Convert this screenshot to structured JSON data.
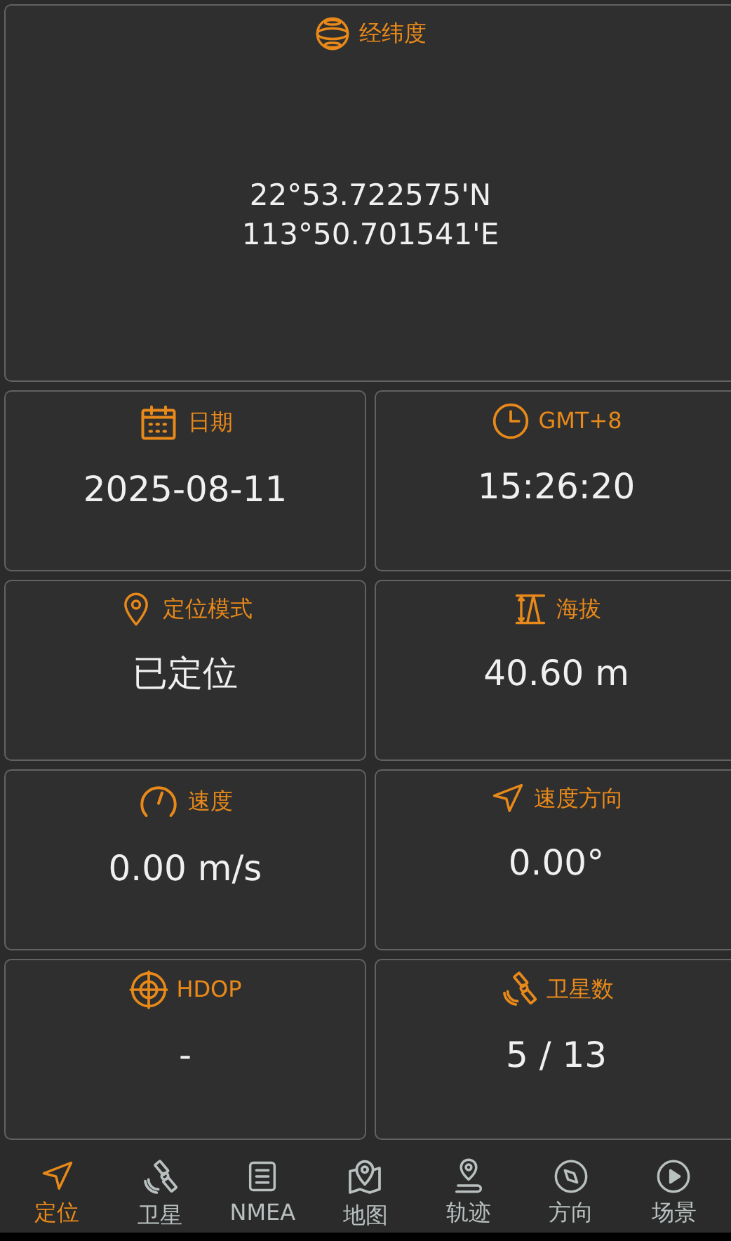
{
  "coordinates": {
    "label": "经纬度",
    "lines": [
      "22°53.722575'N",
      "113°50.701541'E"
    ]
  },
  "cards": [
    {
      "label": "日期",
      "value": "2025-08-11"
    },
    {
      "label": "GMT+8",
      "value": "15:26:20"
    },
    {
      "label": "定位模式",
      "value": "已定位"
    },
    {
      "label": "海拔",
      "value": "40.60 m"
    },
    {
      "label": "速度",
      "value": "0.00 m/s"
    },
    {
      "label": "速度方向",
      "value": "0.00°"
    },
    {
      "label": "HDOP",
      "value": "-"
    },
    {
      "label": "卫星数",
      "value": "5 / 13"
    }
  ],
  "nav": [
    {
      "label": "定位",
      "selected": true
    },
    {
      "label": "卫星",
      "selected": false
    },
    {
      "label": "NMEA",
      "selected": false
    },
    {
      "label": "地图",
      "selected": false
    },
    {
      "label": "轨迹",
      "selected": false
    },
    {
      "label": "方向",
      "selected": false
    },
    {
      "label": "场景",
      "selected": false
    }
  ]
}
